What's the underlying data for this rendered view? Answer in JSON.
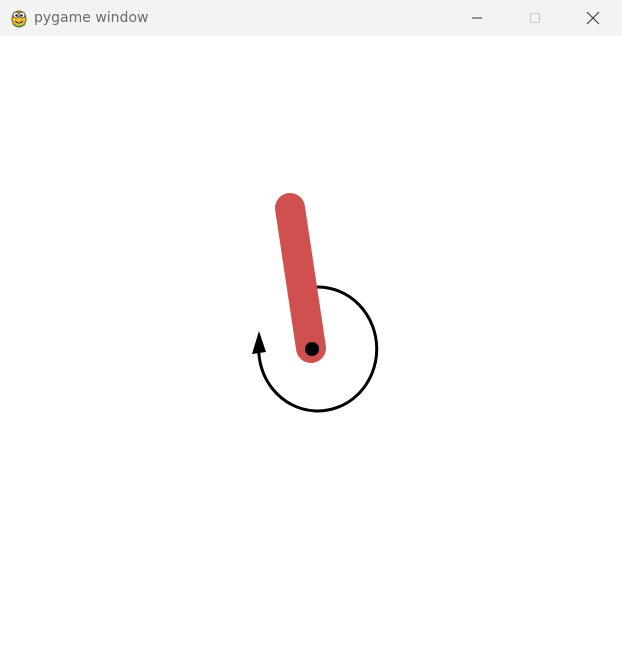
{
  "window": {
    "title": "pygame window",
    "app_icon": "pygame-snake-icon",
    "controls": [
      "minimize-icon",
      "maximize-icon",
      "close-icon"
    ]
  },
  "scene": {
    "description_icons": [
      "pendulum-pole",
      "pivot-dot",
      "rotation-arrow-icon"
    ],
    "colors": {
      "background": "#ffffff",
      "titlebar": "#f3f3f3",
      "pole": "#d04f4f",
      "pivot": "#000000",
      "arrow": "#000000"
    }
  }
}
